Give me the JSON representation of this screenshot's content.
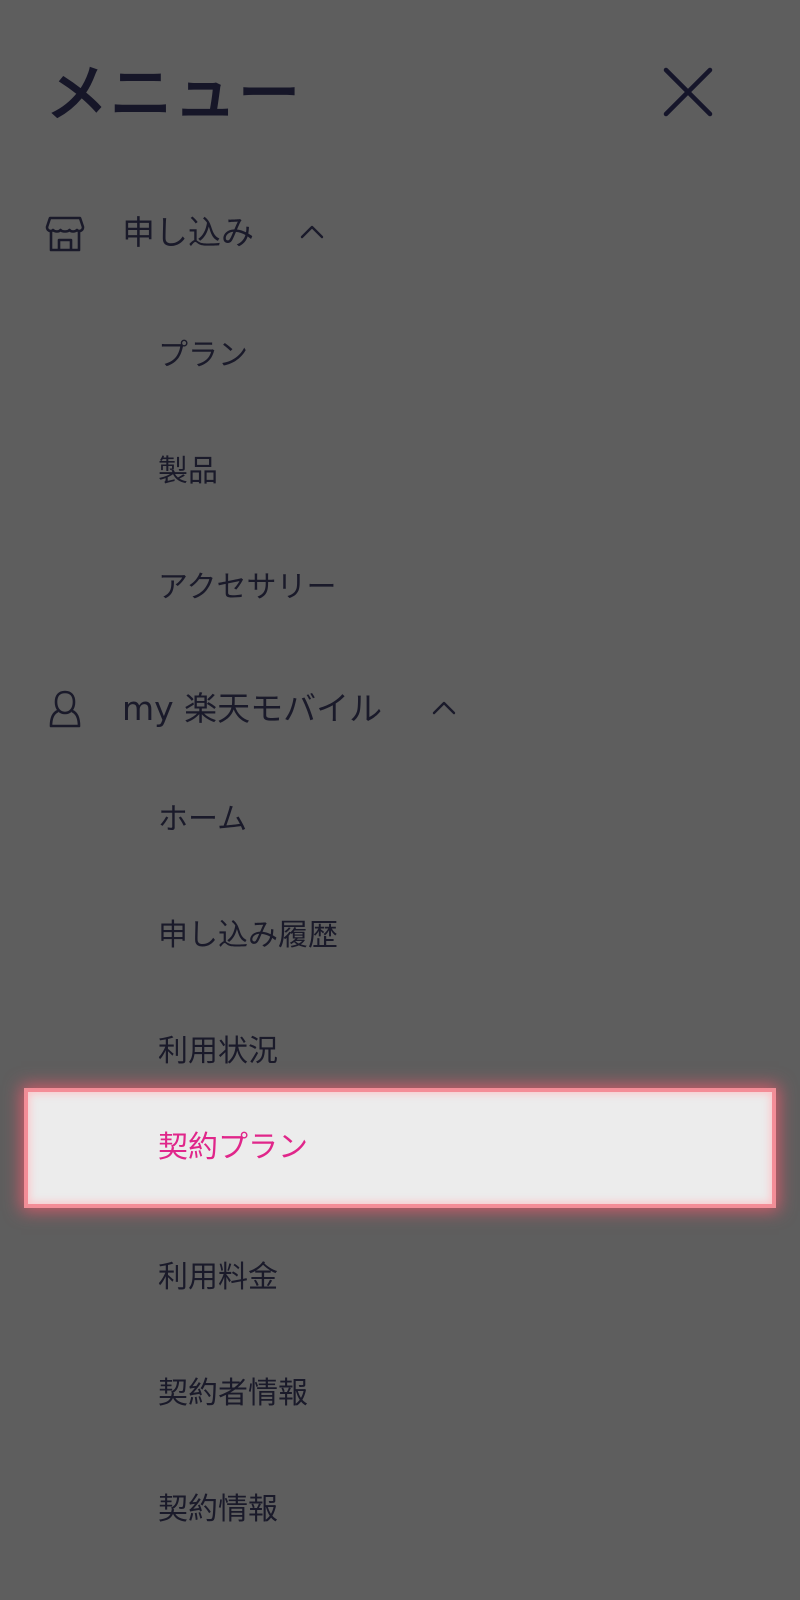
{
  "menu": {
    "title": "メニュー",
    "close_icon": "close-icon"
  },
  "sections": [
    {
      "label": "申し込み",
      "icon": "store-icon",
      "expanded": true,
      "items": [
        {
          "label": "プラン"
        },
        {
          "label": "製品"
        },
        {
          "label": "アクセサリー"
        }
      ]
    },
    {
      "label": "my 楽天モバイル",
      "icon": "user-icon",
      "expanded": true,
      "items": [
        {
          "label": "ホーム"
        },
        {
          "label": "申し込み履歴"
        },
        {
          "label": "利用状況"
        },
        {
          "label": "契約プラン",
          "active": true
        },
        {
          "label": "利用料金"
        },
        {
          "label": "契約者情報"
        },
        {
          "label": "契約情報"
        }
      ]
    }
  ],
  "colors": {
    "background": "#5e5e5e",
    "text": "#1a1a2a",
    "active_text": "#e0268a",
    "active_background": "#ececec",
    "highlight_glow": "#f05a6e"
  }
}
